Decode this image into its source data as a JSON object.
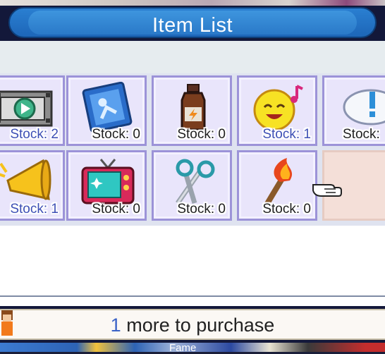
{
  "window": {
    "title": "Item List"
  },
  "items": [
    {
      "name": "Film Reel",
      "icon": "film-reel-icon",
      "stock_label": "Stock: 2",
      "owned": true
    },
    {
      "name": "Blue Card",
      "icon": "blue-card-icon",
      "stock_label": "Stock: 0",
      "owned": false
    },
    {
      "name": "Energy Drink",
      "icon": "bottle-icon",
      "stock_label": "Stock: 0",
      "owned": false
    },
    {
      "name": "Happy Face",
      "icon": "smiley-note-icon",
      "stock_label": "Stock: 1",
      "owned": true
    },
    {
      "name": "Idea Cloud",
      "icon": "speech-cloud-icon",
      "stock_label": "Stock:",
      "owned": false
    },
    {
      "name": "Megaphone",
      "icon": "megaphone-icon",
      "stock_label": "Stock: 1",
      "owned": true
    },
    {
      "name": "Television",
      "icon": "tv-icon",
      "stock_label": "Stock: 0",
      "owned": false
    },
    {
      "name": "Scissors",
      "icon": "scissors-icon",
      "stock_label": "Stock: 0",
      "owned": false
    },
    {
      "name": "Torch",
      "icon": "torch-icon",
      "stock_label": "Stock: 0",
      "owned": false
    }
  ],
  "footer": {
    "count": "1",
    "text": " more to purchase"
  },
  "bottom_bar": {
    "label": "Fame"
  },
  "colors": {
    "title_bar": "#2a7fd1",
    "cell_border": "#9c93d8",
    "owned_text": "#3d4fb5"
  }
}
